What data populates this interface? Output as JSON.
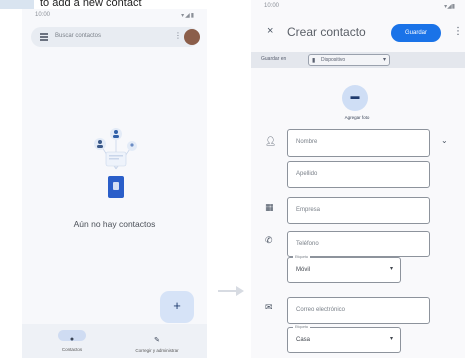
{
  "caption": {
    "text": "to add a new contact",
    "accent_color": "#d9e4f0"
  },
  "left_screen": {
    "status": {
      "time": "10:00",
      "icons": "▾◢▮"
    },
    "search_bar": {
      "placeholder": "Buscar contactos",
      "more_icon": "more-vert-icon"
    },
    "empty_state": {
      "text": "Aún no hay contactos"
    },
    "fab": {
      "label": "+"
    },
    "bottom_nav": {
      "items": [
        {
          "label": "Contactos",
          "icon": "person-icon",
          "active": true
        },
        {
          "label": "Corregir y administrar",
          "icon": "wrench-icon",
          "active": false
        }
      ]
    }
  },
  "right_screen": {
    "status": {
      "time": "10:00",
      "icons": "▾◢▮"
    },
    "app_bar": {
      "close": "×",
      "title": "Crear contacto",
      "save": "Guardar",
      "more": "⋮",
      "save_color": "#1a73e8"
    },
    "save_to": {
      "label": "Guardar en",
      "account": "Dispositivo"
    },
    "photo": {
      "label": "Agregar foto"
    },
    "fields": {
      "nombre": "Nombre",
      "apellido": "Apellido",
      "empresa": "Empresa",
      "telefono": "Teléfono",
      "correo": "Correo electrónico"
    },
    "phone_type": {
      "legend": "Etiqueta",
      "value": "Móvil"
    },
    "email_type": {
      "legend": "Etiqueta",
      "value": "Casa"
    }
  }
}
